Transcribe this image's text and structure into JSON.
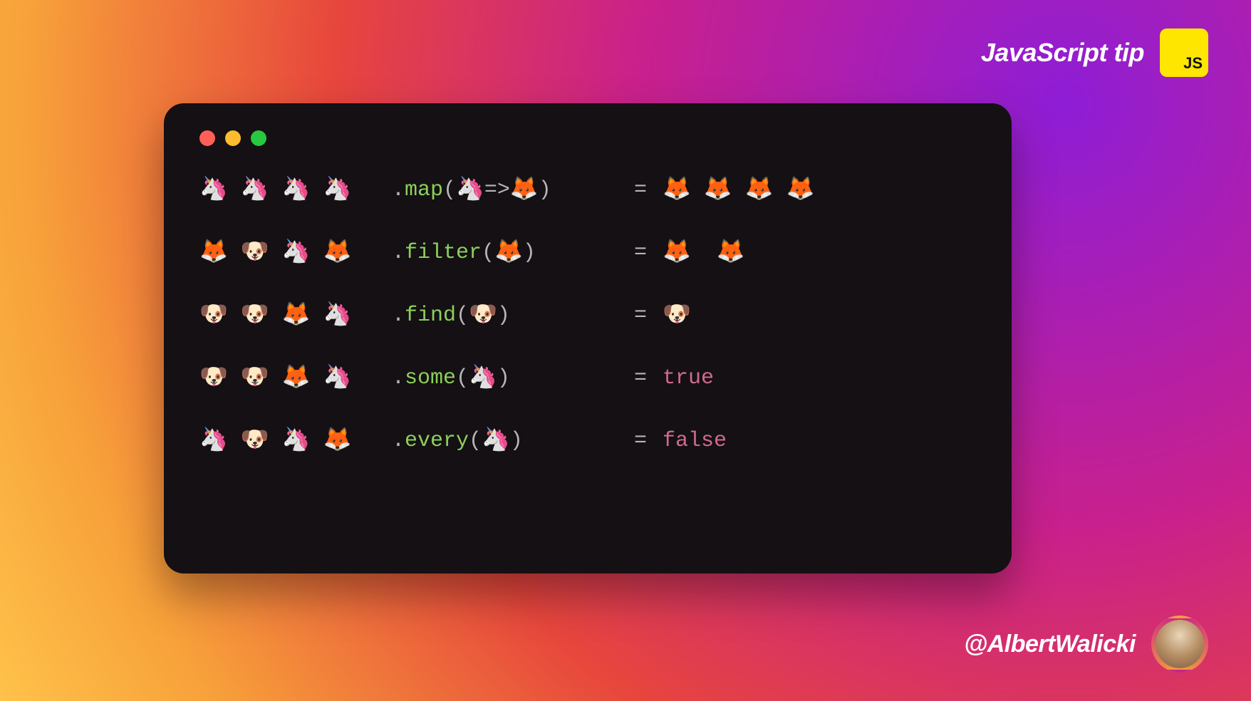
{
  "header": {
    "title": "JavaScript tip",
    "badge": "JS"
  },
  "footer": {
    "handle": "@AlbertWalicki"
  },
  "emoji": {
    "unicorn": "🦄",
    "fox": "🦊",
    "dog": "🐶"
  },
  "code": {
    "rows": [
      {
        "input": [
          "unicorn",
          "unicorn",
          "unicorn",
          "unicorn"
        ],
        "dot": ".",
        "method": "map",
        "open": "(",
        "argEmoji": "unicorn",
        "arrow": " => ",
        "argEmoji2": "fox",
        "close": ")",
        "eq": "=",
        "output": {
          "type": "emojis",
          "items": [
            "fox",
            "fox",
            "fox",
            "fox"
          ]
        }
      },
      {
        "input": [
          "fox",
          "dog",
          "unicorn",
          "fox"
        ],
        "dot": ".",
        "method": "filter",
        "open": "(",
        "argEmoji": "fox",
        "close": ")",
        "eq": "=",
        "output": {
          "type": "emojis",
          "items": [
            "fox",
            "fox"
          ],
          "gap": true
        }
      },
      {
        "input": [
          "dog",
          "dog",
          "fox",
          "unicorn"
        ],
        "dot": ".",
        "method": "find",
        "open": "(",
        "argEmoji": "dog",
        "close": ")",
        "eq": "=",
        "output": {
          "type": "emojis",
          "items": [
            "dog"
          ]
        }
      },
      {
        "input": [
          "dog",
          "dog",
          "fox",
          "unicorn"
        ],
        "dot": ".",
        "method": "some",
        "open": "(",
        "argEmoji": "unicorn",
        "close": ")",
        "eq": "=",
        "output": {
          "type": "keyword",
          "value": "true"
        }
      },
      {
        "input": [
          "unicorn",
          "dog",
          "unicorn",
          "fox"
        ],
        "dot": ".",
        "method": "every",
        "open": "(",
        "argEmoji": "unicorn",
        "close": ")",
        "eq": "=",
        "output": {
          "type": "keyword",
          "value": "false"
        }
      }
    ]
  }
}
